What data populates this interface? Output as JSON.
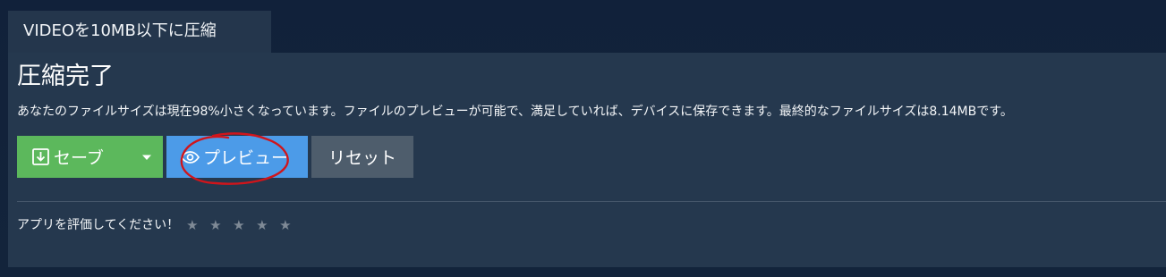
{
  "tab": {
    "label": "VIDEOを10MB以下に圧縮"
  },
  "panel": {
    "title": "圧縮完了",
    "description": "あなたのファイルサイズは現在98%小さくなっています。ファイルのプレビューが可能で、満足していれば、デバイスに保存できます。最終的なファイルサイズは8.14MBです。"
  },
  "buttons": {
    "save_label": "セーブ",
    "save_icon": "download-icon",
    "dropdown_icon": "caret-down-icon",
    "preview_label": "プレビュー",
    "preview_icon": "eye-icon",
    "reset_label": "リセット"
  },
  "rating": {
    "prompt": "アプリを評価してください！",
    "stars": [
      "★",
      "★",
      "★",
      "★",
      "★"
    ],
    "value": 0
  },
  "colors": {
    "background": "#13243b",
    "panel": "#25384e",
    "save": "#5cb85c",
    "preview": "#4c9be8",
    "reset": "#4e5d6c",
    "annotation": "#d0151b",
    "star_inactive": "#7f8a96"
  }
}
